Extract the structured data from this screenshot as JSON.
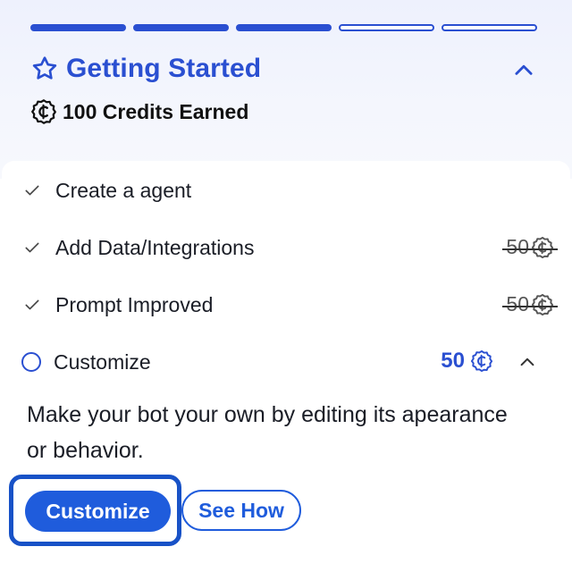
{
  "progress": {
    "total_steps": 5,
    "completed_steps": 3
  },
  "header": {
    "title": "Getting Started",
    "credits_label": "100 Credits Earned",
    "icon": "star-icon",
    "collapse_icon": "chevron-up-icon"
  },
  "tasks": [
    {
      "label": "Create a agent",
      "done": true,
      "reward": ""
    },
    {
      "label": "Add Data/Integrations",
      "done": true,
      "reward": "50"
    },
    {
      "label": "Prompt Improved",
      "done": true,
      "reward": "50"
    },
    {
      "label": "Customize",
      "done": false,
      "reward": "50"
    }
  ],
  "active_task": {
    "description": "Make your bot your own by editing its apearance or behavior.",
    "primary_button": "Customize",
    "secondary_button": "See How"
  },
  "colors": {
    "accent": "#2a4fd1",
    "button": "#1f5cdc",
    "focus": "#1852c7"
  }
}
